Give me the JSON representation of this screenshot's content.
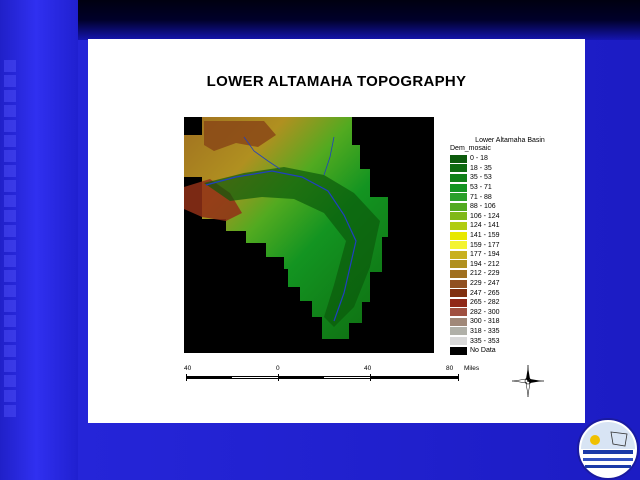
{
  "slide": {
    "title": "LOWER ALTAMAHA TOPOGRAPHY"
  },
  "legend": {
    "title": "Lower Altamaha Basin",
    "field": "Dem_mosaic",
    "entries": [
      {
        "label": "0 - 18",
        "color": "#0c5a0c"
      },
      {
        "label": "18 - 35",
        "color": "#0e6b10"
      },
      {
        "label": "35 - 53",
        "color": "#108018"
      },
      {
        "label": "53 - 71",
        "color": "#139421"
      },
      {
        "label": "71 - 88",
        "color": "#2aa02a"
      },
      {
        "label": "88 - 106",
        "color": "#52aa20"
      },
      {
        "label": "106 - 124",
        "color": "#80b818"
      },
      {
        "label": "124 - 141",
        "color": "#b0cc10"
      },
      {
        "label": "141 - 159",
        "color": "#e8e800"
      },
      {
        "label": "159 - 177",
        "color": "#f4f430"
      },
      {
        "label": "177 - 194",
        "color": "#c8b020"
      },
      {
        "label": "194 - 212",
        "color": "#b09020"
      },
      {
        "label": "212 - 229",
        "color": "#a07020"
      },
      {
        "label": "229 - 247",
        "color": "#905020"
      },
      {
        "label": "247 - 265",
        "color": "#803010"
      },
      {
        "label": "265 - 282",
        "color": "#902818"
      },
      {
        "label": "282 - 300",
        "color": "#a05040"
      },
      {
        "label": "300 - 318",
        "color": "#a08878"
      },
      {
        "label": "318 - 335",
        "color": "#b0b0a8"
      },
      {
        "label": "335 - 353",
        "color": "#d8d8d8"
      },
      {
        "label": "No Data",
        "color": "#000000"
      }
    ]
  },
  "scale_bar": {
    "labels": [
      "40",
      "0",
      "40",
      "80"
    ],
    "units": "Miles"
  },
  "colors": {
    "background": "#2525d8",
    "slide": "#ffffff",
    "no_data": "#000000"
  }
}
